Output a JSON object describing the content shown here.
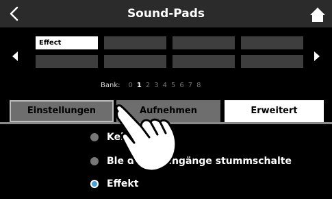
{
  "header": {
    "title": "Sound-Pads",
    "back_icon": "chevron-left-icon",
    "home_icon": "home-icon"
  },
  "pads": {
    "rows": [
      [
        "Effect",
        "",
        "",
        ""
      ],
      [
        "",
        "",
        "",
        ""
      ]
    ],
    "prev_icon": "triangle-left-icon",
    "next_icon": "triangle-right-icon"
  },
  "bank": {
    "label": "Bank:",
    "numbers": [
      "0",
      "1",
      "2",
      "3",
      "4",
      "5",
      "6",
      "7",
      "8"
    ],
    "current": "1"
  },
  "tabs": [
    {
      "label": "Einstellungen"
    },
    {
      "label": "Aufnehmen"
    },
    {
      "label": "Erweitert"
    }
  ],
  "options": [
    {
      "label": "Kei",
      "selected": false
    },
    {
      "label": "Ble deren Eingänge stummschalte",
      "selected": false
    },
    {
      "label": "Effekt",
      "selected": true
    }
  ],
  "colors": {
    "selected_radio": "#4a9fd5",
    "active_tab": "#ffffff",
    "inactive_tab": "#6e6e6e"
  }
}
